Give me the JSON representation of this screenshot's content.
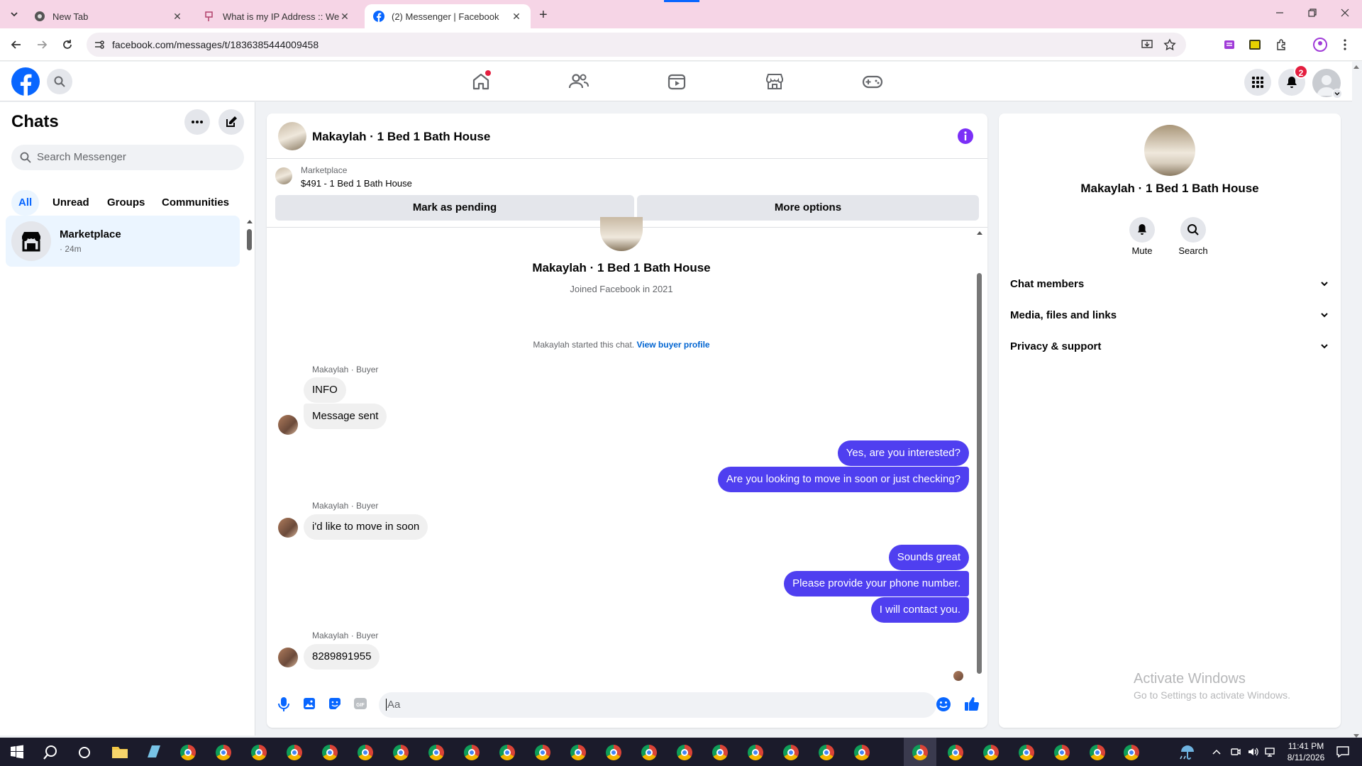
{
  "browser": {
    "tabs": [
      {
        "title": "New Tab"
      },
      {
        "title": "What is my IP Address :: WebBr"
      },
      {
        "title": "(2) Messenger | Facebook"
      }
    ],
    "url": "facebook.com/messages/t/1836385444009458"
  },
  "fb": {
    "notification_count": "2"
  },
  "chats": {
    "title": "Chats",
    "search_placeholder": "Search Messenger",
    "filters": [
      "All",
      "Unread",
      "Groups",
      "Communities"
    ],
    "items": [
      {
        "name": "Marketplace",
        "time": "· 24m"
      }
    ]
  },
  "conversation": {
    "header_title": "Makaylah · 1 Bed 1 Bath House",
    "listing": {
      "label": "Marketplace",
      "title": "$491 - 1 Bed 1 Bath House"
    },
    "mark_pending": "Mark as pending",
    "more_options": "More options",
    "intro_name": "Makaylah · 1 Bed 1 Bath House",
    "intro_joined": "Joined Facebook in 2021",
    "started_text": "Makaylah started this chat.",
    "view_buyer_profile": "View buyer profile",
    "sender_label": "Makaylah · Buyer",
    "messages": [
      {
        "text": "INFO"
      },
      {
        "text": "Message sent"
      },
      {
        "text": "Yes, are you interested?"
      },
      {
        "text": "Are you looking to move in soon or just checking?"
      },
      {
        "text": "i'd like to move in soon"
      },
      {
        "text": "Sounds great"
      },
      {
        "text": "Please provide your phone number."
      },
      {
        "text": "I will contact you."
      },
      {
        "text": "8289891955"
      }
    ],
    "composer_placeholder": "Aa"
  },
  "details": {
    "name": "Makaylah · 1 Bed 1 Bath House",
    "mute_label": "Mute",
    "search_label": "Search",
    "sections": [
      "Chat members",
      "Media, files and links",
      "Privacy & support"
    ]
  },
  "watermark": {
    "line1": "Activate Windows",
    "line2": "Go to Settings to activate Windows."
  },
  "taskbar": {
    "time": "11:41 PM",
    "date": "8/11/2026"
  }
}
